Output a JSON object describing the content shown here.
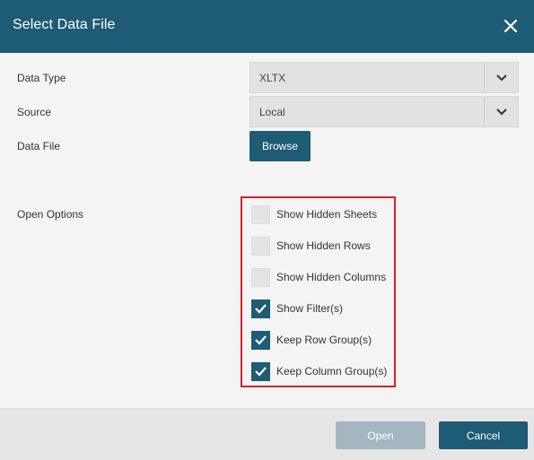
{
  "dialog": {
    "title": "Select Data File"
  },
  "fields": {
    "data_type_label": "Data Type",
    "data_type_value": "XLTX",
    "source_label": "Source",
    "source_value": "Local",
    "data_file_label": "Data File",
    "browse_label": "Browse"
  },
  "open_options": {
    "label": "Open Options",
    "items": [
      {
        "label": "Show Hidden Sheets",
        "checked": false
      },
      {
        "label": "Show Hidden Rows",
        "checked": false
      },
      {
        "label": "Show Hidden Columns",
        "checked": false
      },
      {
        "label": "Show Filter(s)",
        "checked": true
      },
      {
        "label": "Keep Row Group(s)",
        "checked": true
      },
      {
        "label": "Keep Column Group(s)",
        "checked": true
      }
    ]
  },
  "footer": {
    "open_label": "Open",
    "cancel_label": "Cancel"
  },
  "colors": {
    "accent": "#1e5b74",
    "highlight_border": "#d9202b",
    "disabled_button": "#a4b7c0"
  },
  "icons": {
    "close": "close-icon",
    "dropdown": "chevron-down-icon",
    "check": "checkmark-icon"
  }
}
